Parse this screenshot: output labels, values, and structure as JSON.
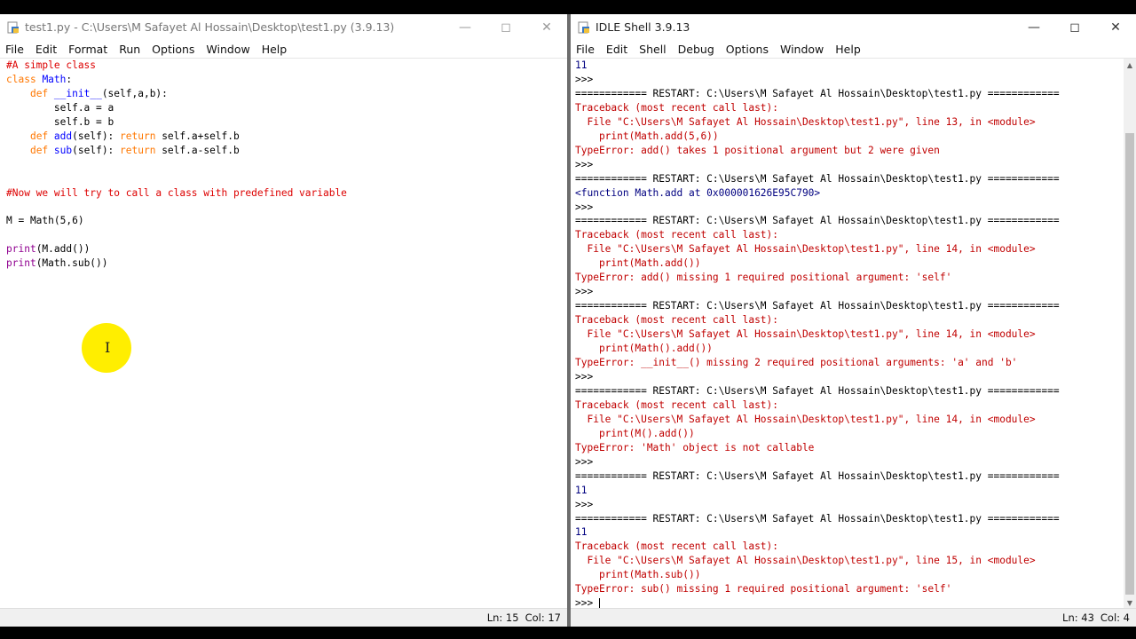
{
  "editor": {
    "title": "test1.py - C:\\Users\\M Safayet Al Hossain\\Desktop\\test1.py (3.9.13)",
    "menu": [
      "File",
      "Edit",
      "Format",
      "Run",
      "Options",
      "Window",
      "Help"
    ],
    "code": [
      "#A simple class",
      "class Math:",
      "    def __init__(self,a,b):",
      "        self.a = a",
      "        self.b = b",
      "    def add(self): return self.a+self.b",
      "    def sub(self): return self.a-self.b",
      "",
      "",
      "#Now we will try to call a class with predefined variable",
      "",
      "M = Math(5,6)",
      "",
      "print(M.add())",
      "print(Math.sub())"
    ],
    "status_ln": "Ln: 15",
    "status_col": "Col: 17"
  },
  "shell": {
    "title": "IDLE Shell 3.9.13",
    "menu": [
      "File",
      "Edit",
      "Shell",
      "Debug",
      "Options",
      "Window",
      "Help"
    ],
    "lines": [
      {
        "t": "11",
        "c": "out"
      },
      {
        "t": ">>> ",
        "c": ""
      },
      {
        "t": "============ RESTART: C:\\Users\\M Safayet Al Hossain\\Desktop\\test1.py ============",
        "c": ""
      },
      {
        "t": "Traceback (most recent call last):",
        "c": "err"
      },
      {
        "t": "  File \"C:\\Users\\M Safayet Al Hossain\\Desktop\\test1.py\", line 13, in <module>",
        "c": "err"
      },
      {
        "t": "    print(Math.add(5,6))",
        "c": "err"
      },
      {
        "t": "TypeError: add() takes 1 positional argument but 2 were given",
        "c": "err"
      },
      {
        "t": ">>> ",
        "c": ""
      },
      {
        "t": "============ RESTART: C:\\Users\\M Safayet Al Hossain\\Desktop\\test1.py ============",
        "c": ""
      },
      {
        "t": "<function Math.add at 0x000001626E95C790>",
        "c": "out"
      },
      {
        "t": ">>> ",
        "c": ""
      },
      {
        "t": "============ RESTART: C:\\Users\\M Safayet Al Hossain\\Desktop\\test1.py ============",
        "c": ""
      },
      {
        "t": "Traceback (most recent call last):",
        "c": "err"
      },
      {
        "t": "  File \"C:\\Users\\M Safayet Al Hossain\\Desktop\\test1.py\", line 14, in <module>",
        "c": "err"
      },
      {
        "t": "    print(Math.add())",
        "c": "err"
      },
      {
        "t": "TypeError: add() missing 1 required positional argument: 'self'",
        "c": "err"
      },
      {
        "t": ">>> ",
        "c": ""
      },
      {
        "t": "============ RESTART: C:\\Users\\M Safayet Al Hossain\\Desktop\\test1.py ============",
        "c": ""
      },
      {
        "t": "Traceback (most recent call last):",
        "c": "err"
      },
      {
        "t": "  File \"C:\\Users\\M Safayet Al Hossain\\Desktop\\test1.py\", line 14, in <module>",
        "c": "err"
      },
      {
        "t": "    print(Math().add())",
        "c": "err"
      },
      {
        "t": "TypeError: __init__() missing 2 required positional arguments: 'a' and 'b'",
        "c": "err"
      },
      {
        "t": ">>> ",
        "c": ""
      },
      {
        "t": "============ RESTART: C:\\Users\\M Safayet Al Hossain\\Desktop\\test1.py ============",
        "c": ""
      },
      {
        "t": "Traceback (most recent call last):",
        "c": "err"
      },
      {
        "t": "  File \"C:\\Users\\M Safayet Al Hossain\\Desktop\\test1.py\", line 14, in <module>",
        "c": "err"
      },
      {
        "t": "    print(M().add())",
        "c": "err"
      },
      {
        "t": "TypeError: 'Math' object is not callable",
        "c": "err"
      },
      {
        "t": ">>> ",
        "c": ""
      },
      {
        "t": "============ RESTART: C:\\Users\\M Safayet Al Hossain\\Desktop\\test1.py ============",
        "c": ""
      },
      {
        "t": "11",
        "c": "out"
      },
      {
        "t": ">>> ",
        "c": ""
      },
      {
        "t": "============ RESTART: C:\\Users\\M Safayet Al Hossain\\Desktop\\test1.py ============",
        "c": ""
      },
      {
        "t": "11",
        "c": "out"
      },
      {
        "t": "Traceback (most recent call last):",
        "c": "err"
      },
      {
        "t": "  File \"C:\\Users\\M Safayet Al Hossain\\Desktop\\test1.py\", line 15, in <module>",
        "c": "err"
      },
      {
        "t": "    print(Math.sub())",
        "c": "err"
      },
      {
        "t": "TypeError: sub() missing 1 required positional argument: 'self'",
        "c": "err"
      },
      {
        "t": ">>> ",
        "c": "prompt"
      }
    ],
    "status_ln": "Ln: 43",
    "status_col": "Col: 4"
  },
  "colors": {
    "keyword": "#ff7700",
    "comment": "#dd0000",
    "definition": "#0000ff",
    "builtin": "#900090",
    "error": "#c00000",
    "stdout": "#000080",
    "highlight": "#ffee00"
  },
  "icons": [
    "python-file-icon",
    "minimize-icon",
    "maximize-icon",
    "close-icon",
    "scroll-up-icon",
    "scroll-down-icon",
    "text-cursor-icon"
  ]
}
